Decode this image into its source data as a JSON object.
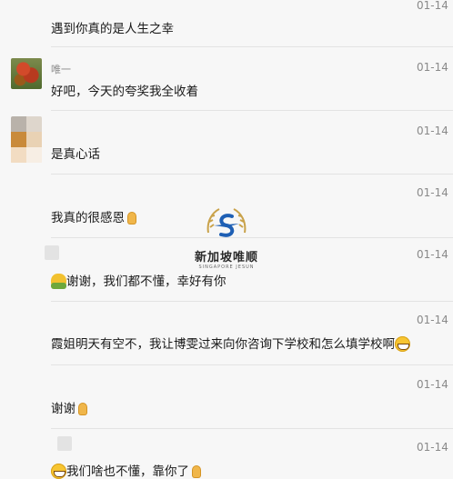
{
  "messages": [
    {
      "avatar": "none",
      "name": "",
      "time": "01-14",
      "text": "遇到你真的是人生之幸",
      "emoji": []
    },
    {
      "avatar": "photo",
      "name": "唯一",
      "time": "01-14",
      "text": "好吧，今天的夸奖我全收着",
      "emoji": []
    },
    {
      "avatar": "mosaic",
      "name": "",
      "time": "01-14",
      "text": "是真心话",
      "emoji": []
    },
    {
      "avatar": "none",
      "name": "",
      "time": "01-14",
      "text": "我真的很感恩",
      "emoji": [
        "pray-emoji"
      ]
    },
    {
      "avatar": "small",
      "name": "",
      "time": "01-14",
      "text": "谢谢，我们都不懂，幸好有你",
      "emoji": [
        "hug-emoji"
      ]
    },
    {
      "avatar": "none",
      "name": "",
      "time": "01-14",
      "text": "霞姐明天有空不，我让博雯过来向你咨询下学校和怎么填学校啊",
      "emoji": [
        "grin-emoji"
      ]
    },
    {
      "avatar": "none",
      "name": "",
      "time": "01-14",
      "text": "谢谢",
      "emoji": [
        "pray-emoji"
      ]
    },
    {
      "avatar": "small",
      "name": "",
      "time": "01-14",
      "text": "我们啥也不懂，靠你了",
      "emoji": [
        "grin-emoji",
        "pray-emoji"
      ]
    }
  ],
  "watermark": {
    "title": "新加坡唯顺",
    "subtitle": "SINGAPORE JESUN",
    "logo_icon": "s-wings-logo",
    "accent": "#1e5fb4",
    "gold": "#c9a24a"
  }
}
